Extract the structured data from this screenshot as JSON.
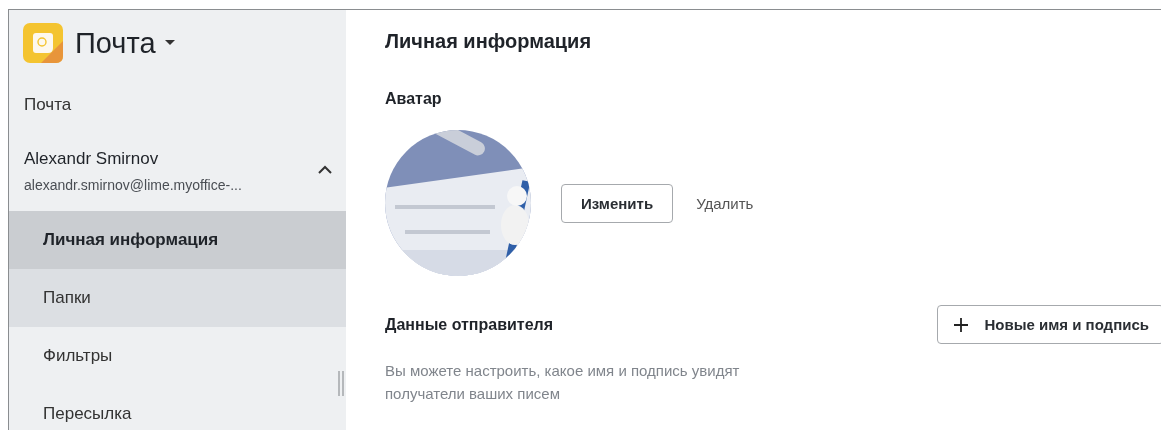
{
  "app": {
    "title": "Почта"
  },
  "sidebar": {
    "section": "Почта",
    "account": {
      "name": "Alexandr Smirnov",
      "email": "alexandr.smirnov@lime.myoffice-...",
      "expanded": true
    },
    "items": [
      {
        "label": "Личная информация",
        "selected": true,
        "highlighted": false
      },
      {
        "label": "Папки",
        "selected": false,
        "highlighted": true
      },
      {
        "label": "Фильтры",
        "selected": false,
        "highlighted": false
      },
      {
        "label": "Пересылка",
        "selected": false,
        "highlighted": false
      }
    ]
  },
  "main": {
    "title": "Личная информация",
    "avatar": {
      "heading": "Аватар",
      "change_button": "Изменить",
      "delete_link": "Удалить"
    },
    "sender": {
      "heading": "Данные отправителя",
      "add_button": "Новые имя и подпись",
      "description": "Вы можете настроить, какое имя и подпись увидят получатели ваших писем"
    }
  }
}
